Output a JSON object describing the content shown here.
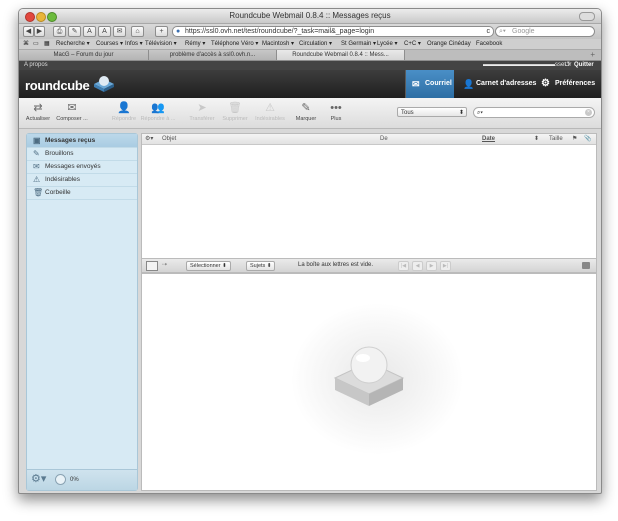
{
  "browser": {
    "window_title": "Roundcube Webmail 0.8.4 :: Messages reçus",
    "nav_buttons": [
      "◀",
      "▶",
      "⎙",
      "✎",
      "A",
      "A",
      "✉",
      "⌂",
      "+"
    ],
    "url": "https://ssl0.ovh.net/test/roundcube/?_task=mail&_page=login",
    "reload_glyph": "c",
    "search_placeholder": "Google",
    "bookmarks": [
      "Recherche ▾",
      "Courses ▾",
      "Infos ▾",
      "Télévision ▾",
      "Rémy ▾",
      "Téléphone",
      "Véro ▾",
      "Macintosh ▾",
      "Circulation ▾",
      "St Germain ▾",
      "Lycée ▾",
      "C+C ▾",
      "Orange Cinéday",
      "Facebook"
    ],
    "tabs": [
      "MacG – Forum du jour",
      "problème d'accès à ssl0.ovh.n...",
      "Roundcube Webmail 0.8.4 :: Mess..."
    ],
    "active_tab": 2
  },
  "app": {
    "about": "A propos",
    "user": "▬▬▬▬▬▬▬▬▬▬▬▬sset.fr",
    "logout": "Quitter",
    "logo": "roundcube",
    "main_tabs": [
      "Courriel",
      "Carnet d'adresses",
      "Préférences"
    ],
    "toolbar": [
      {
        "label": "Actualiser",
        "icon": "⇄",
        "disabled": false
      },
      {
        "label": "Composer ...",
        "icon": "✉",
        "disabled": false
      },
      {
        "label": "Répondre",
        "icon": "👤",
        "disabled": true
      },
      {
        "label": "Répondre à ...",
        "icon": "👥",
        "disabled": true
      },
      {
        "label": "Transférer",
        "icon": "➤",
        "disabled": true
      },
      {
        "label": "Supprimer",
        "icon": "🗑",
        "disabled": true
      },
      {
        "label": "Indésirables",
        "icon": "⚠",
        "disabled": true
      },
      {
        "label": "Marquer",
        "icon": "✎",
        "disabled": false
      },
      {
        "label": "Plus",
        "icon": "•••",
        "disabled": false
      }
    ],
    "filter": "Tous",
    "search_value": "",
    "folders": [
      {
        "label": "Messages reçus",
        "icon": "inbox-icon",
        "glyph": "▣"
      },
      {
        "label": "Brouillons",
        "icon": "pencil-icon",
        "glyph": "✎"
      },
      {
        "label": "Messages envoyés",
        "icon": "sent-icon",
        "glyph": "✉"
      },
      {
        "label": "Indésirables",
        "icon": "junk-icon",
        "glyph": "⚠"
      },
      {
        "label": "Corbeille",
        "icon": "trash-icon",
        "glyph": "🗑"
      }
    ],
    "quota": "0%",
    "columns": {
      "subject": "Objet",
      "from": "De",
      "date": "Date",
      "size": "Taille",
      "flag": "⚑",
      "attachment": "📎"
    },
    "list_footer": {
      "select": "Sélectionner",
      "threads": "Sujets",
      "status": "La boîte aux lettres est vide."
    }
  }
}
